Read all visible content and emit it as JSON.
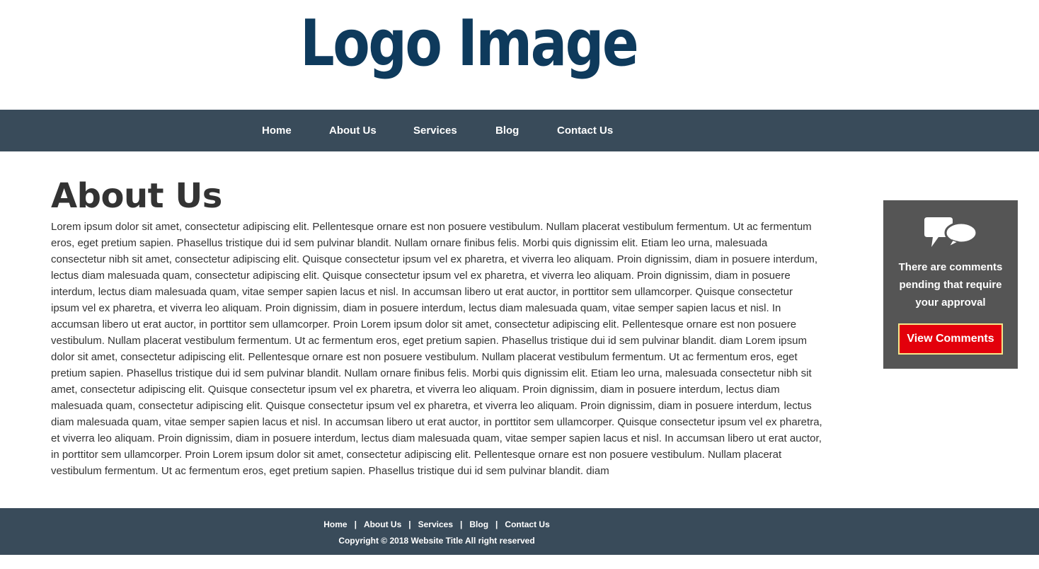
{
  "logo": {
    "text": "Logo Image"
  },
  "nav": {
    "items": [
      {
        "label": "Home"
      },
      {
        "label": "About Us"
      },
      {
        "label": "Services"
      },
      {
        "label": "Blog"
      },
      {
        "label": "Contact Us"
      }
    ]
  },
  "main": {
    "title": "About Us",
    "body": "Lorem ipsum dolor sit amet, consectetur adipiscing elit. Pellentesque ornare est non posuere vestibulum. Nullam placerat vestibulum fermentum. Ut ac fermentum eros, eget pretium sapien. Phasellus tristique dui id sem pulvinar blandit. Nullam ornare finibus felis. Morbi quis dignissim elit. Etiam leo urna, malesuada consectetur nibh sit amet, consectetur adipiscing elit. Quisque consectetur ipsum vel ex pharetra, et viverra leo aliquam. Proin dignissim, diam in posuere interdum, lectus diam malesuada quam, consectetur adipiscing elit. Quisque consectetur ipsum vel ex pharetra, et viverra leo aliquam. Proin dignissim, diam in posuere interdum, lectus diam malesuada quam, vitae semper sapien lacus et nisl. In accumsan libero ut erat auctor, in porttitor sem ullamcorper. Quisque consectetur ipsum vel ex pharetra, et viverra leo aliquam. Proin dignissim, diam in posuere interdum, lectus diam malesuada quam, vitae semper sapien lacus et nisl. In accumsan libero ut erat auctor, in porttitor sem ullamcorper. Proin Lorem ipsum dolor sit amet, consectetur adipiscing elit. Pellentesque ornare est non posuere vestibulum. Nullam placerat vestibulum fermentum. Ut ac fermentum eros, eget pretium sapien. Phasellus tristique dui id sem pulvinar blandit. diam Lorem ipsum dolor sit amet, consectetur adipiscing elit. Pellentesque ornare est non posuere vestibulum. Nullam placerat vestibulum fermentum. Ut ac fermentum eros, eget pretium sapien. Phasellus tristique dui id sem pulvinar blandit. Nullam ornare finibus felis. Morbi quis dignissim elit. Etiam leo urna, malesuada consectetur nibh sit amet, consectetur adipiscing elit. Quisque consectetur ipsum vel ex pharetra, et viverra leo aliquam. Proin dignissim, diam in posuere interdum, lectus diam malesuada quam, consectetur adipiscing elit. Quisque consectetur ipsum vel ex pharetra, et viverra leo aliquam. Proin dignissim, diam in posuere interdum, lectus diam malesuada quam, vitae semper sapien lacus et nisl. In accumsan libero ut erat auctor, in porttitor sem ullamcorper. Quisque consectetur ipsum vel ex pharetra, et viverra leo aliquam. Proin dignissim, diam in posuere interdum, lectus diam malesuada quam, vitae semper sapien lacus et nisl. In accumsan libero ut erat auctor, in porttitor sem ullamcorper. Proin Lorem ipsum dolor sit amet, consectetur adipiscing elit. Pellentesque ornare est non posuere vestibulum. Nullam placerat vestibulum fermentum. Ut ac fermentum eros, eget pretium sapien. Phasellus tristique dui id sem pulvinar blandit. diam"
  },
  "sidebar": {
    "icon": "comments-icon",
    "message": "There are comments pending that require your approval",
    "button_label": "View Comments"
  },
  "footer": {
    "links": [
      {
        "label": "Home"
      },
      {
        "label": "About Us"
      },
      {
        "label": "Services"
      },
      {
        "label": "Blog"
      },
      {
        "label": "Contact Us"
      }
    ],
    "separator": "|",
    "copyright": "Copyright © 2018 Website Title All right reserved"
  },
  "colors": {
    "nav_background": "#394b5a",
    "logo": "#0e3a5c",
    "card_background": "#555555",
    "button_background": "#e3000b",
    "button_border": "#f5e88a",
    "heading": "#333333"
  }
}
